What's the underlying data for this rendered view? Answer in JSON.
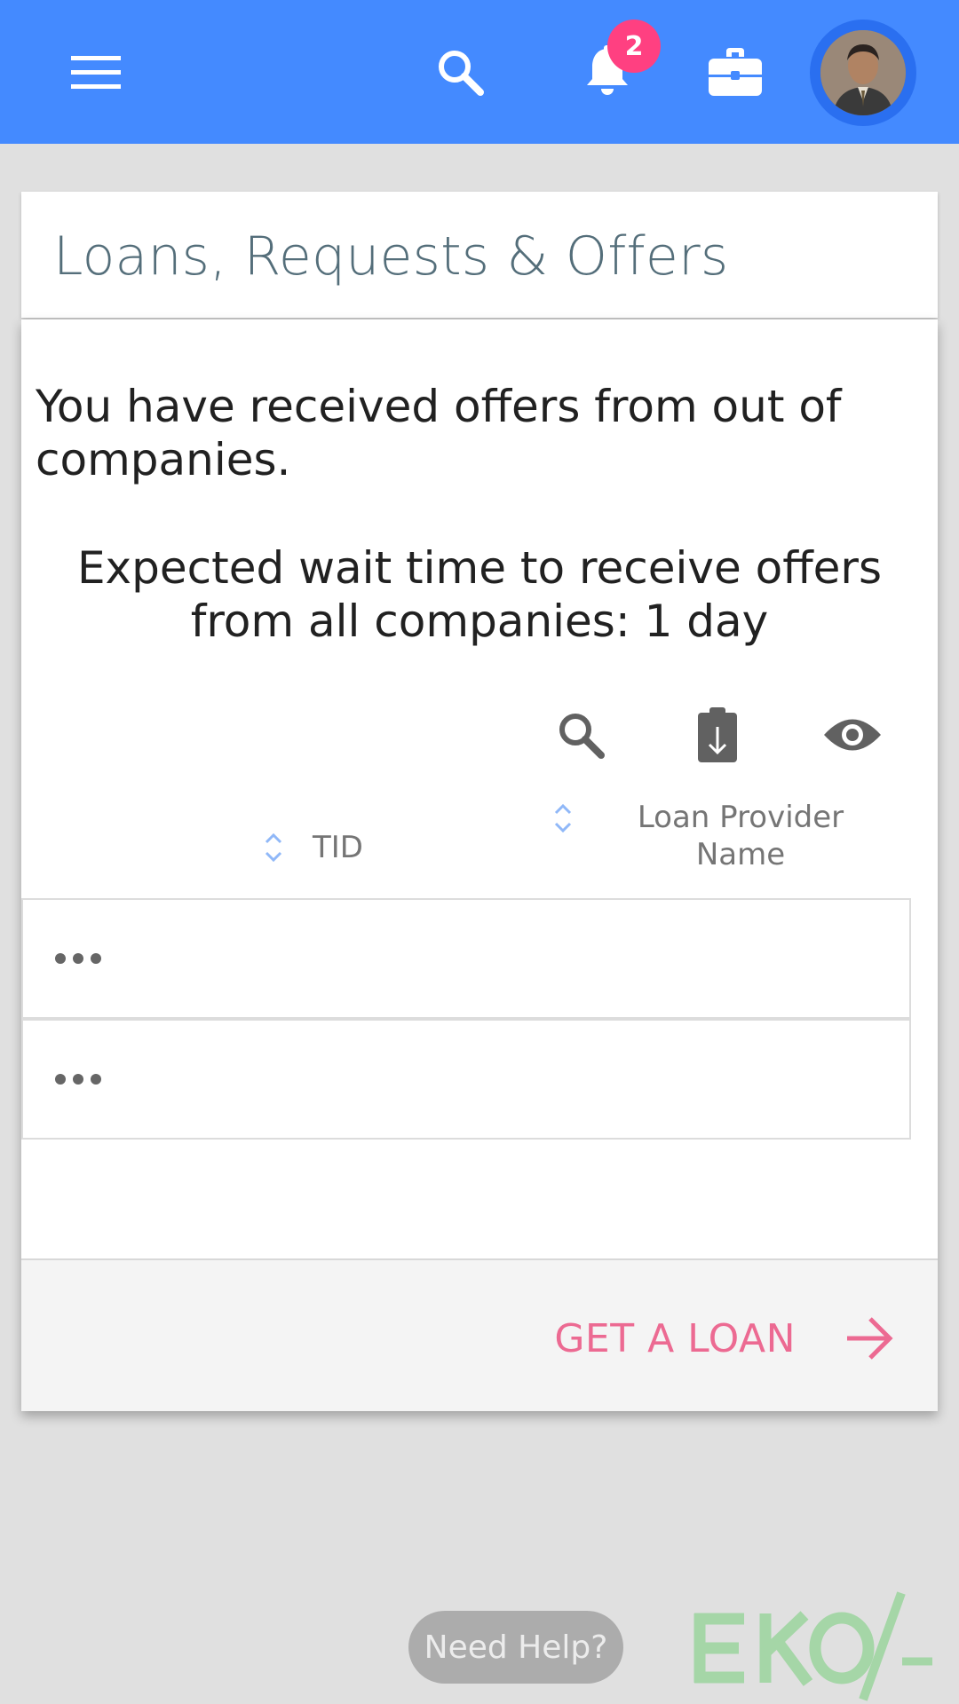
{
  "header": {
    "notification_count": "2",
    "icons": [
      "menu-icon",
      "search-icon",
      "bell-icon",
      "briefcase-icon",
      "avatar"
    ],
    "background": "#448aff",
    "badge_color": "#ff4081"
  },
  "title_card": {
    "title": "Loans, Requests & Offers"
  },
  "main": {
    "offers_message": "You have received offers from out of companies.",
    "wait_message": "Expected wait time to receive offers from all companies: 1 day",
    "toolbar_icons": [
      "search-icon",
      "export-icon",
      "eye-icon"
    ],
    "columns": [
      {
        "label": "TID"
      },
      {
        "label": "Loan Provider Name"
      }
    ],
    "rows": [
      {
        "menu": "•••"
      },
      {
        "menu": "•••"
      }
    ]
  },
  "footer": {
    "action_label": "GET A LOAN",
    "action_color": "#ec6a92"
  },
  "help": {
    "label": "Need Help?"
  },
  "brand": {
    "logo_text": "EKO/-",
    "logo_color": "#a5d6a7"
  }
}
